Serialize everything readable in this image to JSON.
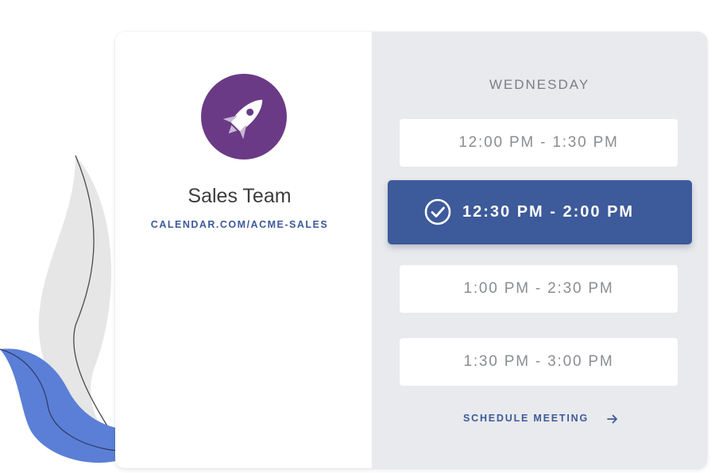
{
  "team": {
    "name": "Sales Team",
    "link": "CALENDAR.COM/ACME-SALES",
    "avatar_icon": "rocket-icon"
  },
  "schedule": {
    "day": "WEDNESDAY",
    "slots": [
      {
        "label": "12:00 PM - 1:30 PM",
        "selected": false
      },
      {
        "label": "12:30 PM - 2:00 PM",
        "selected": true
      },
      {
        "label": "1:00 PM - 2:30 PM",
        "selected": false
      },
      {
        "label": "1:30 PM - 3:00 PM",
        "selected": false
      }
    ],
    "action_label": "SCHEDULE MEETING",
    "action_icon": "arrow-right-icon"
  },
  "colors": {
    "accent": "#3d5a9a",
    "avatar": "#6b3a86",
    "panel_bg": "#e9eaed",
    "decor_blue": "#5b7fd6",
    "decor_gray": "#e6e6e6"
  }
}
